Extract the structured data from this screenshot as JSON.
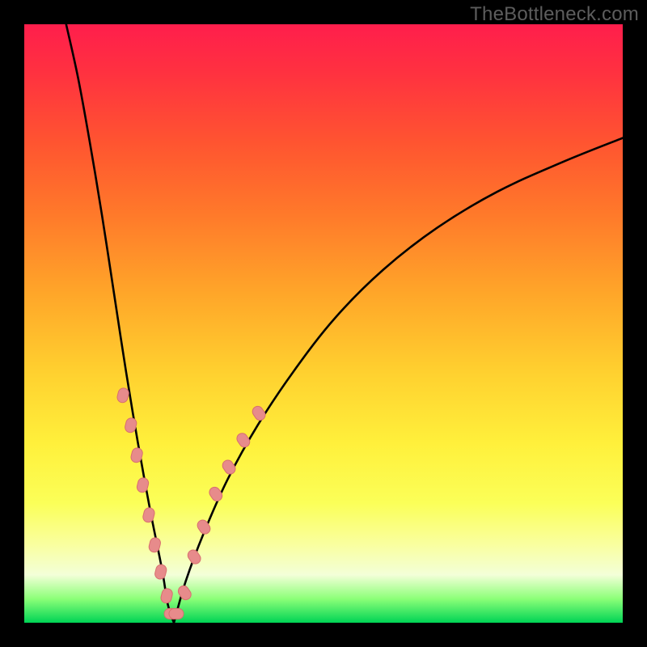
{
  "watermark": "TheBottleneck.com",
  "chart_data": {
    "type": "line",
    "title": "",
    "xlabel": "",
    "ylabel": "",
    "xlim": [
      0,
      100
    ],
    "ylim": [
      0,
      100
    ],
    "grid": false,
    "curve_note": "V-shaped bottleneck curve; left branch is near-vertical, right branch rises with a concave sqrt-like profile. Minimum at x≈25 touching y≈0.",
    "series": [
      {
        "name": "left-branch",
        "x": [
          7,
          9,
          11,
          13,
          15,
          17,
          19,
          21,
          23,
          24,
          25
        ],
        "y": [
          100,
          91,
          80,
          68,
          55,
          42,
          30,
          19,
          9,
          3,
          0
        ]
      },
      {
        "name": "right-branch",
        "x": [
          25,
          27,
          30,
          34,
          39,
          45,
          52,
          60,
          69,
          79,
          90,
          100
        ],
        "y": [
          0,
          7,
          15,
          24,
          33,
          42,
          51,
          59,
          66,
          72,
          77,
          81
        ]
      }
    ],
    "marker_clusters_note": "Pink pill-shaped markers cluster on both branches near the trough (roughly y between 2 and 32).",
    "marker_points": {
      "left": [
        {
          "x": 16.5,
          "y": 38
        },
        {
          "x": 17.8,
          "y": 33
        },
        {
          "x": 18.8,
          "y": 28
        },
        {
          "x": 19.8,
          "y": 23
        },
        {
          "x": 20.8,
          "y": 18
        },
        {
          "x": 21.8,
          "y": 13
        },
        {
          "x": 22.8,
          "y": 8.5
        },
        {
          "x": 23.8,
          "y": 4.5
        }
      ],
      "right": [
        {
          "x": 26.8,
          "y": 5
        },
        {
          "x": 28.4,
          "y": 11
        },
        {
          "x": 30.0,
          "y": 16
        },
        {
          "x": 32.0,
          "y": 21.5
        },
        {
          "x": 34.2,
          "y": 26
        },
        {
          "x": 36.6,
          "y": 30.5
        },
        {
          "x": 39.2,
          "y": 35
        }
      ],
      "bottom": [
        {
          "x": 24.6,
          "y": 1.5
        },
        {
          "x": 25.4,
          "y": 1.5
        }
      ]
    },
    "colors": {
      "curve": "#000000",
      "marker_fill": "#e78b8b",
      "marker_stroke": "#d86f6f",
      "gradient_top": "#ff1e4c",
      "gradient_bottom": "#00d455"
    }
  }
}
